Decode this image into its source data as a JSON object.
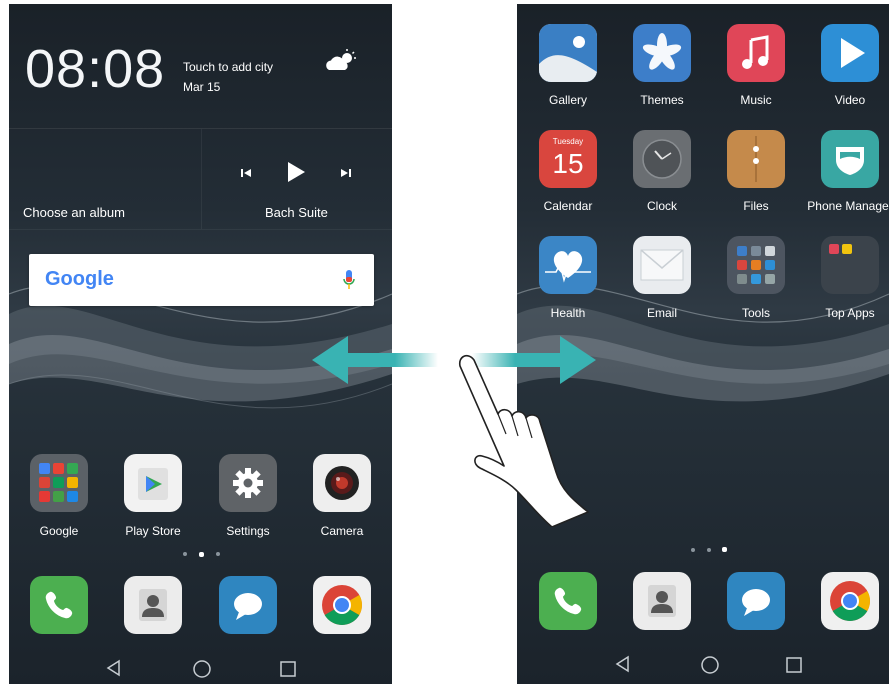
{
  "left_screen": {
    "clock": {
      "time": "08:08",
      "weather_prompt": "Touch to add city",
      "date": "Mar 15"
    },
    "music_widget": {
      "album_prompt": "Choose an album",
      "track": "Bach Suite"
    },
    "search_bar": {
      "logo_text": "Google"
    },
    "apps": [
      {
        "label": "Google"
      },
      {
        "label": "Play Store"
      },
      {
        "label": "Settings"
      },
      {
        "label": "Camera"
      }
    ]
  },
  "right_screen": {
    "apps": [
      {
        "label": "Gallery"
      },
      {
        "label": "Themes"
      },
      {
        "label": "Music"
      },
      {
        "label": "Video"
      },
      {
        "label": "Calendar",
        "calendar_day": "Tuesday",
        "calendar_date": "15"
      },
      {
        "label": "Clock"
      },
      {
        "label": "Files"
      },
      {
        "label": "Phone Manager"
      },
      {
        "label": "Health"
      },
      {
        "label": "Email"
      },
      {
        "label": "Tools"
      },
      {
        "label": "Top Apps"
      }
    ]
  },
  "dock_icons": [
    "phone-icon",
    "contacts-icon",
    "messaging-icon",
    "chrome-icon"
  ],
  "page_indicator": {
    "pages": 3,
    "left_active_index": 1,
    "right_active_index": 2
  },
  "swipe_hint": {
    "icons": [
      "swipe-left-arrow-icon",
      "swipe-right-arrow-icon",
      "hand-pointer-icon"
    ],
    "arrow_color": "#39b3b3"
  },
  "nav_bar": {
    "icons": [
      "back-icon",
      "home-icon",
      "recent-apps-icon"
    ]
  },
  "colors": {
    "phone_green": "#4caf50",
    "messaging_blue": "#2f86c0",
    "music_red": "#e04658",
    "themes_blue": "#3d7ec9",
    "video_blue": "#2d8fd6",
    "calendar_red": "#d9463e",
    "files_brown": "#c58a4b",
    "phone_manager_teal": "#39a7a3"
  }
}
